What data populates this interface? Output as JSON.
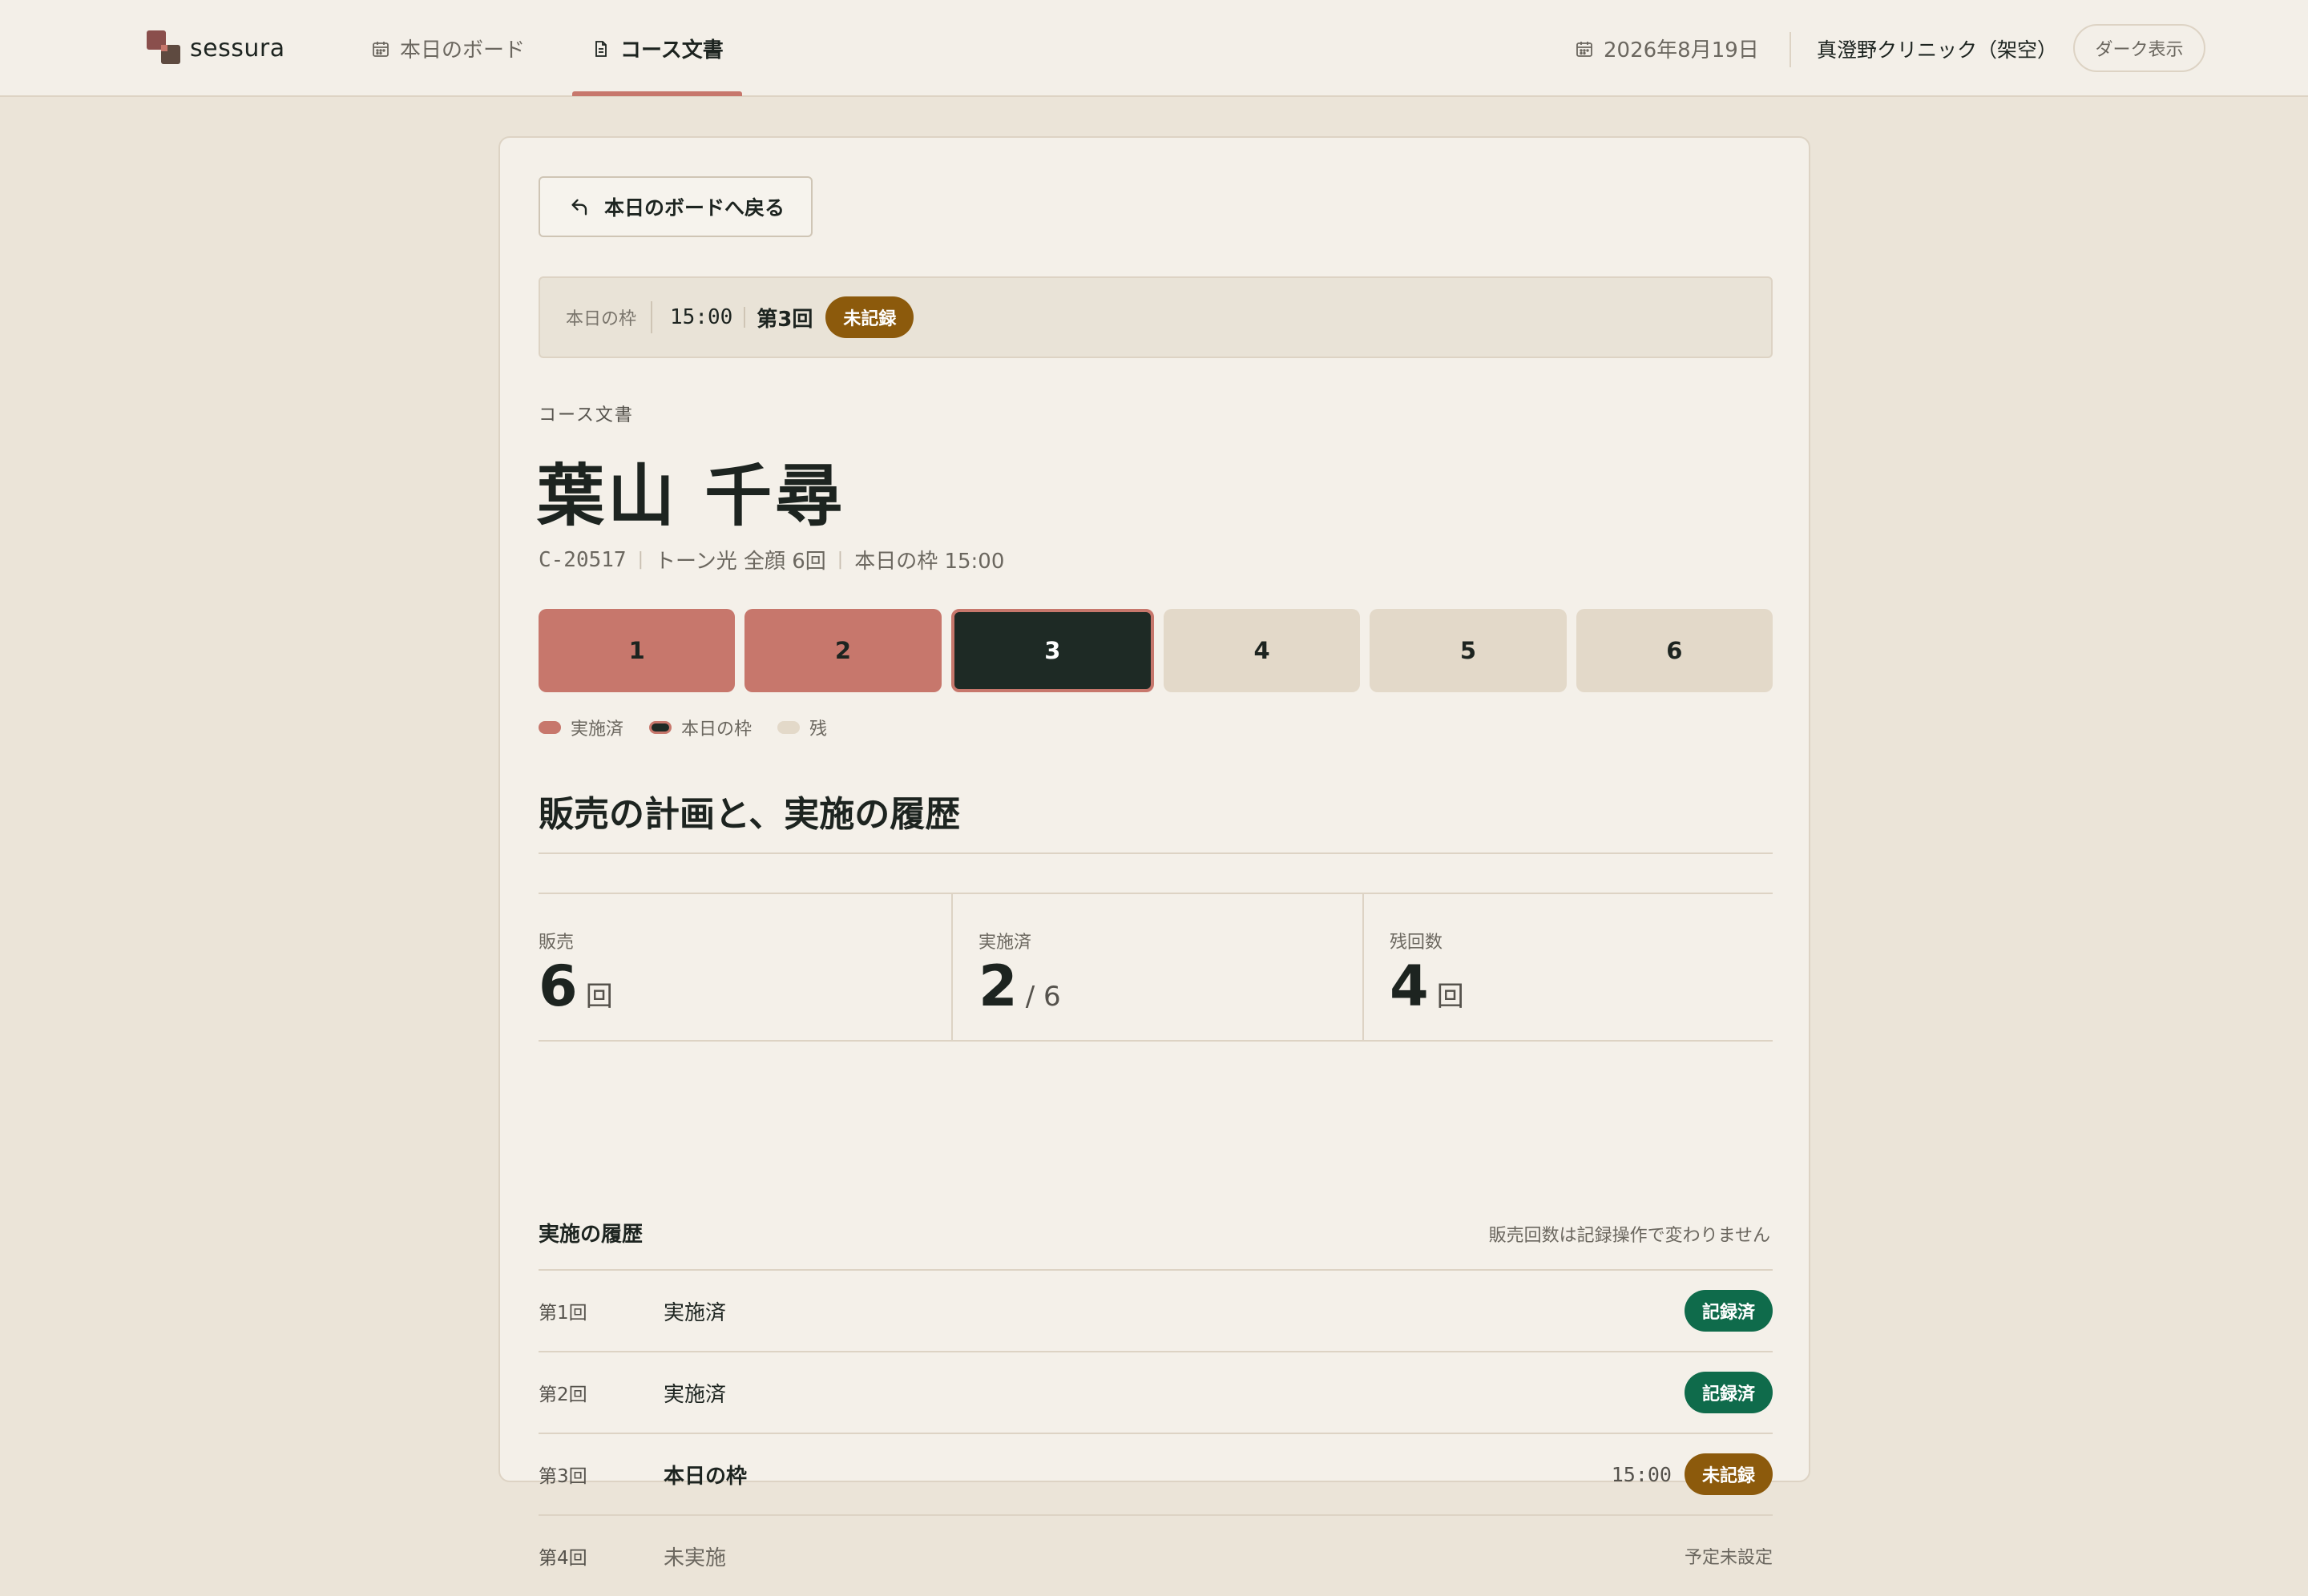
{
  "brand": {
    "name": "sessura"
  },
  "nav": {
    "board_label": "本日のボード",
    "course_label": "コース文書"
  },
  "header": {
    "date": "2026年8月19日",
    "clinic": "真澄野クリニック（架空）",
    "dark_toggle": "ダーク表示"
  },
  "back_button": "本日のボードへ戻る",
  "slot": {
    "label": "本日の枠",
    "time": "15:00",
    "session": "第3回",
    "status": "未記録"
  },
  "document": {
    "eyebrow": "コース文書",
    "client_name": "葉山 千尋",
    "client_id": "C-20517",
    "course": "トーン光 全顔 6回",
    "slot_info": "本日の枠 15:00"
  },
  "sessions": [
    {
      "label": "1",
      "state": "done"
    },
    {
      "label": "2",
      "state": "done"
    },
    {
      "label": "3",
      "state": "current"
    },
    {
      "label": "4",
      "state": "remaining"
    },
    {
      "label": "5",
      "state": "remaining"
    },
    {
      "label": "6",
      "state": "remaining"
    }
  ],
  "legend": {
    "done": "実施済",
    "current": "本日の枠",
    "remaining": "残"
  },
  "section_title": "販売の計画と、実施の履歴",
  "stats": {
    "sold": {
      "label": "販売",
      "value": "6",
      "unit": "回"
    },
    "done": {
      "label": "実施済",
      "value": "2",
      "unit": "/ 6"
    },
    "remaining": {
      "label": "残回数",
      "value": "4",
      "unit": "回"
    }
  },
  "history": {
    "title": "実施の履歴",
    "note": "販売回数は記録操作で変わりません",
    "rows": [
      {
        "num": "第1回",
        "status": "実施済",
        "badge": "記録済"
      },
      {
        "num": "第2回",
        "status": "実施済",
        "badge": "記録済"
      },
      {
        "num": "第3回",
        "status": "本日の枠",
        "time": "15:00",
        "badge": "未記録"
      },
      {
        "num": "第4回",
        "status": "未実施",
        "right": "予定未設定"
      }
    ]
  },
  "colors": {
    "accent": "#c7776c",
    "dark": "#1e2a25",
    "pending": "#8c5a0c",
    "recorded": "#0f6b4b",
    "background": "#ebe4d8"
  }
}
